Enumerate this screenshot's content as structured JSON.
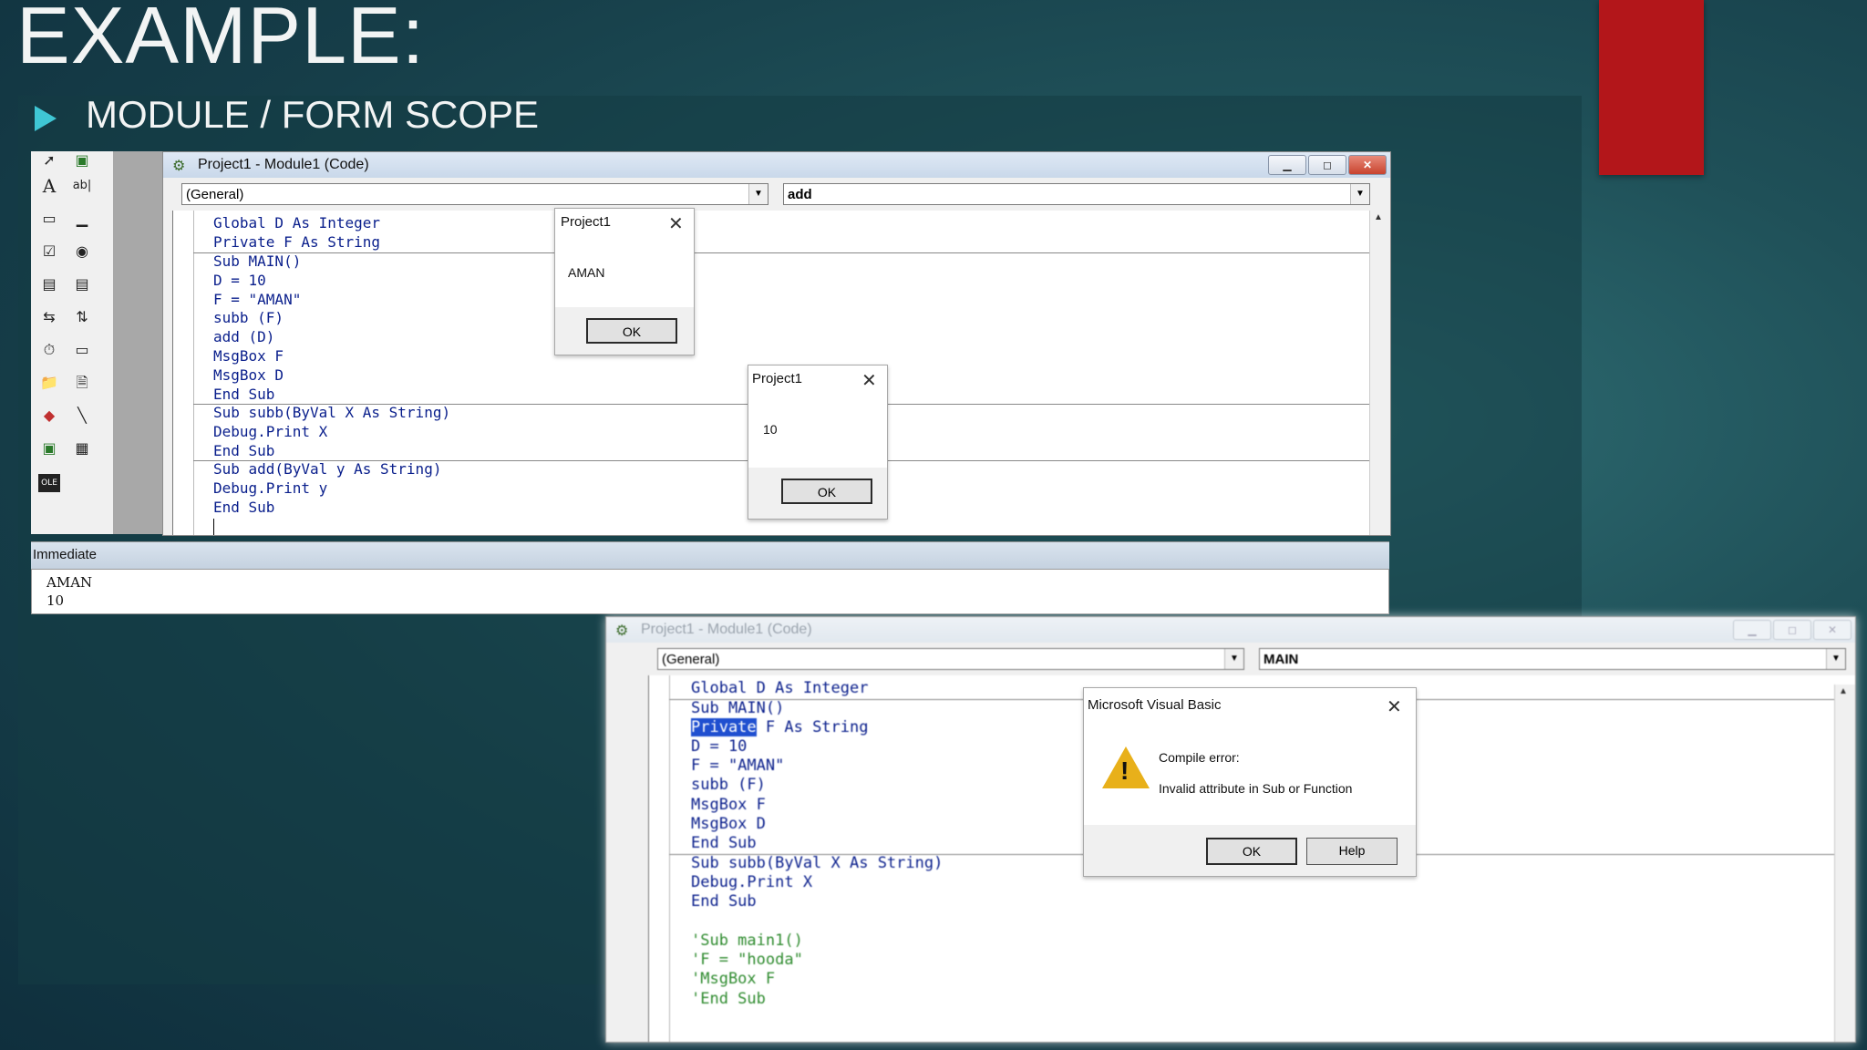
{
  "slide": {
    "title": "EXAMPLE:",
    "subtitle": "MODULE / FORM SCOPE"
  },
  "window1": {
    "title": "Project1 - Module1 (Code)",
    "object_combo": "(General)",
    "proc_combo": "add",
    "code_block1": "Global D As Integer\nPrivate F As String",
    "code_block2": "Sub MAIN()\nD = 10\nF = \"AMAN\"\nsubb (F)\nadd (D)\nMsgBox F\nMsgBox D\nEnd Sub",
    "code_block3": "Sub subb(ByVal X As String)\nDebug.Print X\nEnd Sub",
    "code_block4": "Sub add(ByVal y As String)\nDebug.Print y\nEnd Sub",
    "immediate_title": "Immediate",
    "immediate_output": "AMAN\n10"
  },
  "msgbox1": {
    "title": "Project1",
    "text": "AMAN",
    "ok": "OK"
  },
  "msgbox2": {
    "title": "Project1",
    "text": "10",
    "ok": "OK"
  },
  "window2": {
    "title": "Project1 - Module1 (Code)",
    "object_combo": "(General)",
    "proc_combo": "MAIN",
    "line1": "Global D As Integer",
    "line2": "Sub MAIN()",
    "line3_sel": "Private",
    "line3_rest": " F As String",
    "block_main_rest": "D = 10\nF = \"AMAN\"\nsubb (F)\nMsgBox F\nMsgBox D\nEnd Sub",
    "block_subb": "Sub subb(ByVal X As String)\nDebug.Print X\nEnd Sub",
    "block_comment": "'Sub main1()\n'F = \"hooda\"\n'MsgBox F\n'End Sub"
  },
  "errorbox": {
    "title": "Microsoft Visual Basic",
    "line1": "Compile error:",
    "line2": "Invalid attribute in Sub or Function",
    "ok": "OK",
    "help": "Help"
  },
  "icons": {
    "pointer": "➚",
    "label": "A",
    "textbox": "ab|",
    "frame": "▭",
    "command": "▁",
    "check": "☑",
    "option": "◉",
    "combo": "▤",
    "list": "▤",
    "hscroll": "⇆",
    "vscroll": "⇅",
    "timer": "⏱",
    "drive": "▭",
    "dir": "📁",
    "file": "🗎",
    "shape": "◆",
    "line": "╲",
    "image": "▣",
    "data": "▦",
    "ole": "OLE",
    "ticon": "⚙",
    "close_x": "✕",
    "minimize": "▁",
    "restore": "◻",
    "close": "✕",
    "scroll_up": "▲",
    "dropdown": "▼",
    "warning": "!"
  },
  "colors": {
    "code_blue": "#0a1f8c",
    "comment_green": "#2e8b2e",
    "accent_red": "#b3161a",
    "bullet_cyan": "#3fc6d4",
    "selection": "#1f4fd0"
  }
}
